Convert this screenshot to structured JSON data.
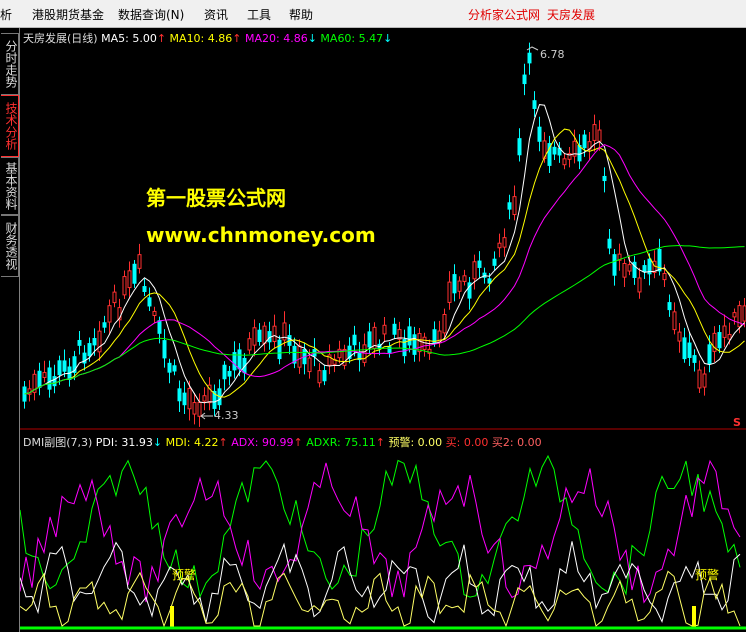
{
  "menu": {
    "items": [
      "析",
      "港股期货基金",
      "数据查询(N)",
      "资讯",
      "工具",
      "帮助"
    ],
    "right_brand": "分析家公式网",
    "right_stock": "天房发展"
  },
  "sidebar": {
    "tabs": [
      "分时走势",
      "技术分析",
      "基本资料",
      "财务透视"
    ],
    "active_index": 1
  },
  "main_chart": {
    "title": "天房发展(日线)",
    "ma5_label": "MA5:",
    "ma5_value": "5.00",
    "ma5_arrow": "↑",
    "ma10_label": "MA10:",
    "ma10_value": "4.86",
    "ma10_arrow": "↑",
    "ma20_label": "MA20:",
    "ma20_value": "4.86",
    "ma20_arrow": "↓",
    "ma60_label": "MA60:",
    "ma60_value": "5.47",
    "ma60_arrow": "↓",
    "high_label": "6.78",
    "low_label": "4.33",
    "s_marker": "S",
    "colors": {
      "ma5": "#ffffff",
      "ma10": "#ffff00",
      "ma20": "#ff00ff",
      "ma60": "#00ff00",
      "up": "#ff3030",
      "down": "#00ffff"
    }
  },
  "watermark": {
    "line1": "第一股票公式网",
    "line2": "www.chnmoney.com"
  },
  "indicator": {
    "title": "DMI副图(7,3)",
    "pdi_label": "PDI:",
    "pdi_value": "31.93",
    "pdi_arrow": "↓",
    "mdi_label": "MDI:",
    "mdi_value": "4.22",
    "mdi_arrow": "↑",
    "adx_label": "ADX:",
    "adx_value": "90.99",
    "adx_arrow": "↑",
    "adxr_label": "ADXR:",
    "adxr_value": "75.11",
    "adxr_arrow": "↑",
    "warn_label": "预警:",
    "warn_value": "0.00",
    "buy_label": "买:",
    "buy_value": "0.00",
    "buy2_label": "买2:",
    "buy2_value": "0.00",
    "warn_marker_1": "预警",
    "warn_marker_2": "预警"
  }
}
